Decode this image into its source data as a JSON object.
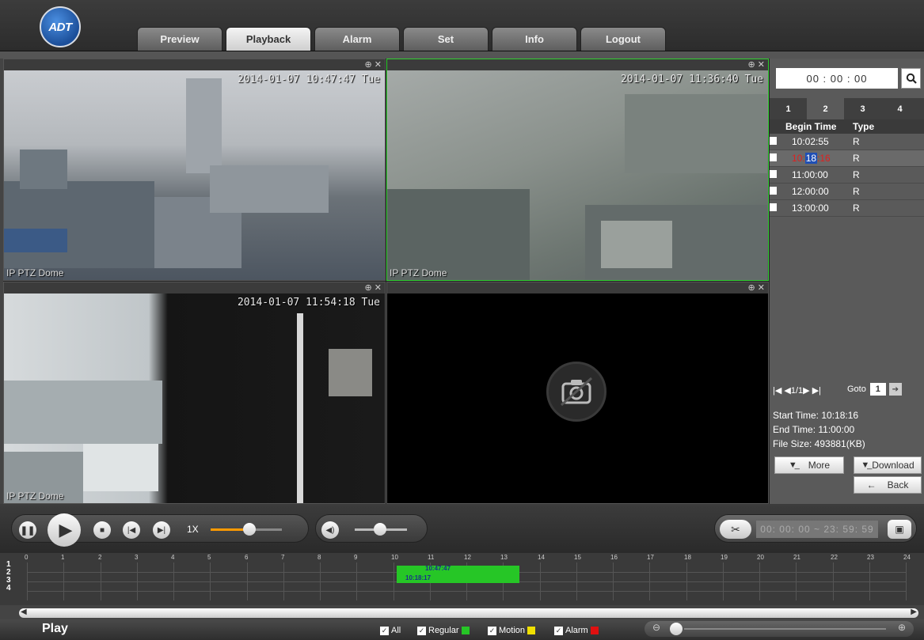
{
  "logo": {
    "text": "ADT"
  },
  "tabs": [
    {
      "label": "Preview"
    },
    {
      "label": "Playback"
    },
    {
      "label": "Alarm"
    },
    {
      "label": "Set"
    },
    {
      "label": "Info"
    },
    {
      "label": "Logout"
    }
  ],
  "active_tab": "Playback",
  "panes": [
    {
      "timestamp": "2014-01-07 10:47:47 Tue",
      "camera": "IP PTZ Dome"
    },
    {
      "timestamp": "2014-01-07 11:36:40 Tue",
      "camera": "IP PTZ Dome"
    },
    {
      "timestamp": "2014-01-07 11:54:18 Tue",
      "camera": "IP PTZ Dome"
    },
    {
      "timestamp": "",
      "camera": ""
    }
  ],
  "search": {
    "time": "00 : 00 : 00"
  },
  "channel_tabs": [
    "1",
    "2",
    "3",
    "4"
  ],
  "file_table": {
    "headers": {
      "begin": "Begin Time",
      "type": "Type"
    },
    "rows": [
      {
        "begin": "10:02:55",
        "type": "R"
      },
      {
        "begin_a": "10:",
        "begin_b": "18",
        "begin_c": ":16",
        "type": "R"
      },
      {
        "begin": "11:00:00",
        "type": "R"
      },
      {
        "begin": "12:00:00",
        "type": "R"
      },
      {
        "begin": "13:00:00",
        "type": "R"
      }
    ]
  },
  "pager": {
    "text": "1/1",
    "goto_label": "Goto",
    "goto_value": "1"
  },
  "file_info": {
    "start": "Start Time: 10:18:16",
    "end": "End Time: 11:00:00",
    "size": "File Size: 493881(KB)"
  },
  "buttons": {
    "more": "More",
    "download": "Download",
    "back": "Back"
  },
  "playback": {
    "speed": "1X",
    "clip_range": "00: 00: 00 ~ 23: 59: 59"
  },
  "timeline": {
    "channels": [
      "1",
      "2",
      "3",
      "4"
    ],
    "hours": [
      "0",
      "1",
      "2",
      "3",
      "4",
      "5",
      "6",
      "7",
      "8",
      "9",
      "10",
      "11",
      "12",
      "13",
      "14",
      "15",
      "16",
      "17",
      "18",
      "19",
      "20",
      "21",
      "22",
      "23",
      "24"
    ],
    "marker1": "10:47:47",
    "marker2": "10:18:17"
  },
  "bottom": {
    "play_label": "Play",
    "legend": [
      {
        "label": "All",
        "color": ""
      },
      {
        "label": "Regular",
        "color": "#26c626"
      },
      {
        "label": "Motion",
        "color": "#f0e000"
      },
      {
        "label": "Alarm",
        "color": "#e01010"
      }
    ]
  },
  "colors": {
    "accent": "#ff9a00",
    "record_regular": "#26c626",
    "active_border": "#30d030"
  }
}
